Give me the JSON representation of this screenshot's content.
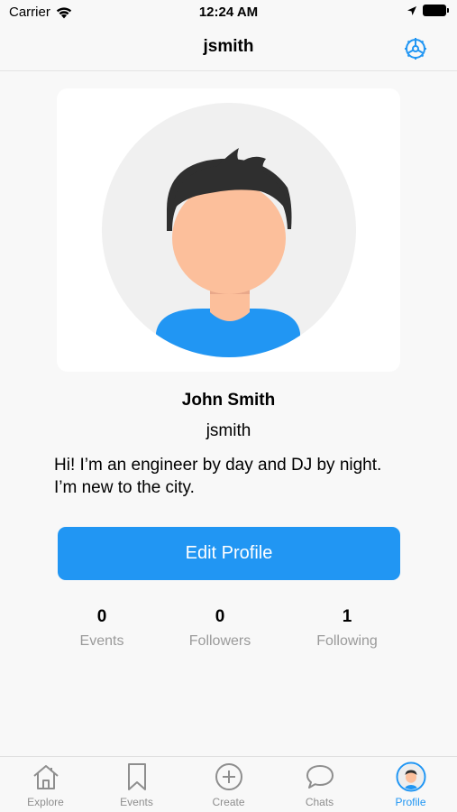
{
  "status_bar": {
    "carrier": "Carrier",
    "time": "12:24 AM"
  },
  "nav": {
    "title": "jsmith",
    "settings_icon": "settings-gear-icon"
  },
  "profile": {
    "name": "John Smith",
    "username": "jsmith",
    "bio": "Hi! I’m an engineer by day and DJ by night. I’m new to the city.",
    "edit_label": "Edit Profile"
  },
  "stats": [
    {
      "value": "0",
      "label": "Events"
    },
    {
      "value": "0",
      "label": "Followers"
    },
    {
      "value": "1",
      "label": "Following"
    }
  ],
  "tabs": [
    {
      "label": "Explore",
      "icon": "home-icon"
    },
    {
      "label": "Events",
      "icon": "bookmark-icon"
    },
    {
      "label": "Create",
      "icon": "plus-circle-icon"
    },
    {
      "label": "Chats",
      "icon": "chat-bubble-icon"
    },
    {
      "label": "Profile",
      "icon": "profile-avatar-icon",
      "active": true
    }
  ],
  "colors": {
    "accent": "#2196f3",
    "background": "#f8f8f8",
    "muted": "#9a9a9a"
  }
}
